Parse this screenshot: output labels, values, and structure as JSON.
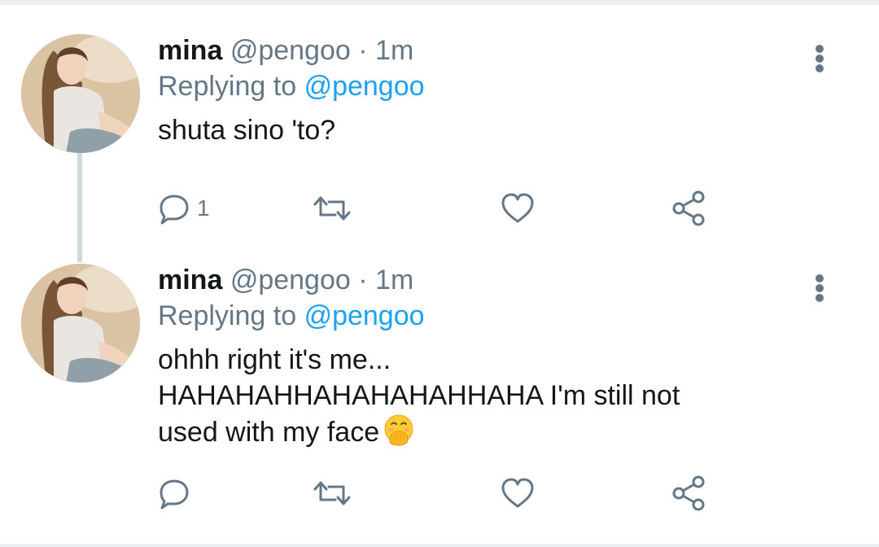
{
  "tweets": [
    {
      "name": "mina",
      "handle": "@pengoo",
      "separator": "·",
      "time": "1m",
      "replying_prefix": "Replying to",
      "replying_to": "@pengoo",
      "lines": [
        "shuta sino 'to?"
      ],
      "emoji": "",
      "reply_count": "1"
    },
    {
      "name": "mina",
      "handle": "@pengoo",
      "separator": "·",
      "time": "1m",
      "replying_prefix": "Replying to",
      "replying_to": "@pengoo",
      "lines": [
        "ohhh right it's me...",
        "HAHAHAHHAHAHAHAHHAHA I'm still not",
        "used with my face"
      ],
      "emoji": "face-with-hand-over-mouth",
      "reply_count": ""
    }
  ],
  "colors": {
    "text": "#14171a",
    "muted": "#657786",
    "link": "#1da1f2",
    "thread_line": "#cfd9de"
  },
  "icons": {
    "reply": "reply-icon",
    "retweet": "retweet-icon",
    "like": "heart-icon",
    "share": "share-icon",
    "more": "more-vertical-icon"
  }
}
